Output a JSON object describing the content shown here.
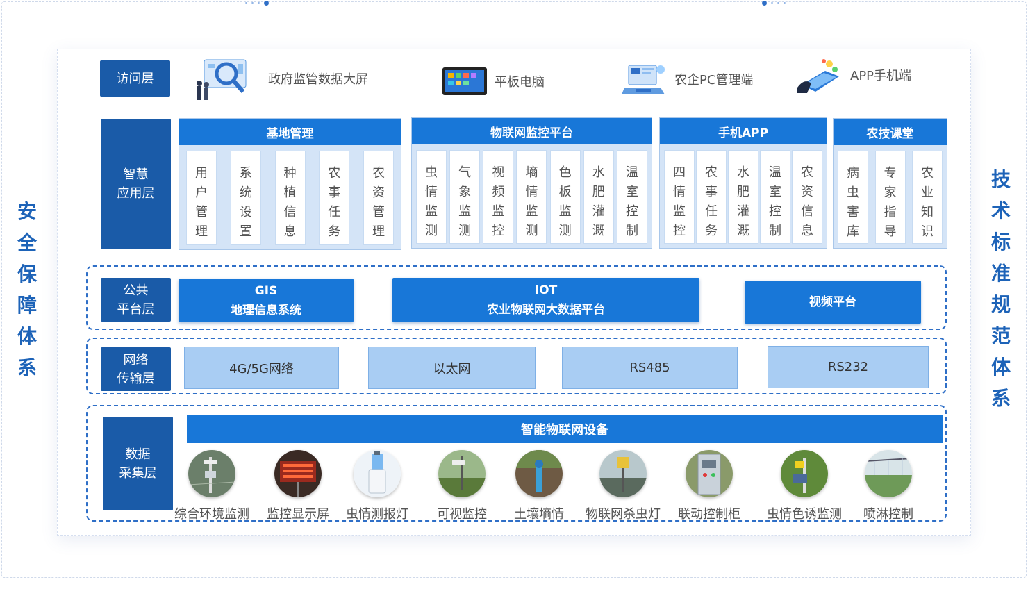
{
  "side": {
    "left": [
      "安",
      "全",
      "保",
      "障",
      "体",
      "系"
    ],
    "right": [
      "技",
      "术",
      "标",
      "准",
      "规",
      "范",
      "体",
      "系"
    ]
  },
  "layers": {
    "access": "访问层",
    "smart_app": [
      "智慧",
      "应用层"
    ],
    "public": [
      "公共",
      "平台层"
    ],
    "network": [
      "网络",
      "传输层"
    ],
    "data": [
      "数据",
      "采集层"
    ]
  },
  "access_items": [
    {
      "label": "政府监管数据大屏",
      "icon": "data-screen-icon"
    },
    {
      "label": "平板电脑",
      "icon": "tablet-icon"
    },
    {
      "label": "农企PC管理端",
      "icon": "pc-icon"
    },
    {
      "label": "APP手机端",
      "icon": "phone-icon"
    }
  ],
  "app_groups": [
    {
      "title": "基地管理",
      "items": [
        [
          "用",
          "户",
          "管",
          "理"
        ],
        [
          "系",
          "统",
          "设",
          "置"
        ],
        [
          "种",
          "植",
          "信",
          "息"
        ],
        [
          "农",
          "事",
          "任",
          "务"
        ],
        [
          "农",
          "资",
          "管",
          "理"
        ]
      ]
    },
    {
      "title": "物联网监控平台",
      "items": [
        [
          "虫",
          "情",
          "监",
          "测"
        ],
        [
          "气",
          "象",
          "监",
          "测"
        ],
        [
          "视",
          "频",
          "监",
          "控"
        ],
        [
          "墒",
          "情",
          "监",
          "测"
        ],
        [
          "色",
          "板",
          "监",
          "测"
        ],
        [
          "水",
          "肥",
          "灌",
          "溉"
        ],
        [
          "温",
          "室",
          "控",
          "制"
        ]
      ]
    },
    {
      "title": "手机APP",
      "items": [
        [
          "四",
          "情",
          "监",
          "控"
        ],
        [
          "农",
          "事",
          "任",
          "务"
        ],
        [
          "水",
          "肥",
          "灌",
          "溉"
        ],
        [
          "温",
          "室",
          "控",
          "制"
        ],
        [
          "农",
          "资",
          "信",
          "息"
        ]
      ]
    },
    {
      "title": "农技课堂",
      "items": [
        [
          "病",
          "虫",
          "害",
          "库"
        ],
        [
          "专",
          "家",
          "指",
          "导"
        ],
        [
          "农",
          "业",
          "知",
          "识"
        ]
      ]
    }
  ],
  "platforms": [
    {
      "line1": "GIS",
      "line2": "地理信息系统"
    },
    {
      "line1": "IOT",
      "line2": "农业物联网大数据平台"
    },
    {
      "line1": "视频平台",
      "line2": ""
    }
  ],
  "networks": [
    "4G/5G网络",
    "以太网",
    "RS485",
    "RS232"
  ],
  "devices_title": "智能物联网设备",
  "devices": [
    {
      "label": "综合环境监测",
      "color": "#6b7f6a"
    },
    {
      "label": "监控显示屏",
      "color": "#9a2a1e"
    },
    {
      "label": "虫情测报灯",
      "color": "#c9d8e8"
    },
    {
      "label": "可视监控",
      "color": "#6a8a4c"
    },
    {
      "label": "土壤墒情",
      "color": "#5b6e4a"
    },
    {
      "label": "物联网杀虫灯",
      "color": "#7d8a82"
    },
    {
      "label": "联动控制柜",
      "color": "#9aa8b4"
    },
    {
      "label": "虫情色诱监测",
      "color": "#5f8a3a"
    },
    {
      "label": "喷淋控制",
      "color": "#6e9a58"
    }
  ],
  "colors": {
    "primary": "#1877d8",
    "dark": "#1a5ba8",
    "light": "#a9cdf3",
    "accent_text": "#1d63b8"
  }
}
